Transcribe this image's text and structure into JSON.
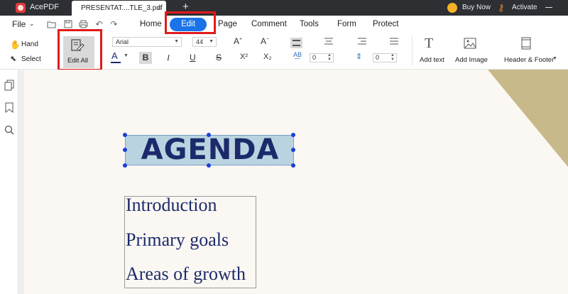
{
  "app": {
    "name": "AcePDF"
  },
  "tabs": {
    "document_tab": "PRESENTAT....TLE_3.pdf",
    "close_symbol": "×",
    "new_tab_symbol": "+"
  },
  "header_right": {
    "buy_now": "Buy Now",
    "activate": "Activate"
  },
  "menu": {
    "file": "File",
    "tabs": [
      "Home",
      "Edit",
      "Page",
      "Comment",
      "Tools",
      "Form",
      "Protect"
    ],
    "active_tab": "Edit"
  },
  "ribbon": {
    "hand": "Hand",
    "select": "Select",
    "edit_all": "Edit All",
    "font_family": "Arial",
    "font_size": "44",
    "font_color_symbol": "A",
    "bold": "B",
    "italic": "I",
    "underline": "U",
    "strikethrough": "S",
    "superscript": "X²",
    "subscript": "X₂",
    "char_spacing_value": "0",
    "line_spacing_value": "0",
    "add_text": "Add text",
    "add_image": "Add Image",
    "header_footer": "Header & Footer"
  },
  "document": {
    "heading": "AGENDA",
    "list_items": [
      "Introduction",
      "Primary goals",
      "Areas of growth"
    ]
  },
  "colors": {
    "accent": "#1a73e8",
    "highlight_box": "#e01b1b",
    "doc_text": "#1c2a6b",
    "deco_gold": "#c8b98a",
    "selection_handle": "#1a3fd9"
  },
  "icons": {
    "app_logo": "acepdf-logo-icon",
    "buy_now": "crown-icon",
    "activate": "key-icon",
    "open": "folder-icon",
    "save": "save-icon",
    "print": "print-icon",
    "undo": "undo-icon",
    "redo": "redo-icon",
    "thumbnails": "pages-icon",
    "bookmark": "bookmark-icon",
    "search": "search-icon"
  }
}
